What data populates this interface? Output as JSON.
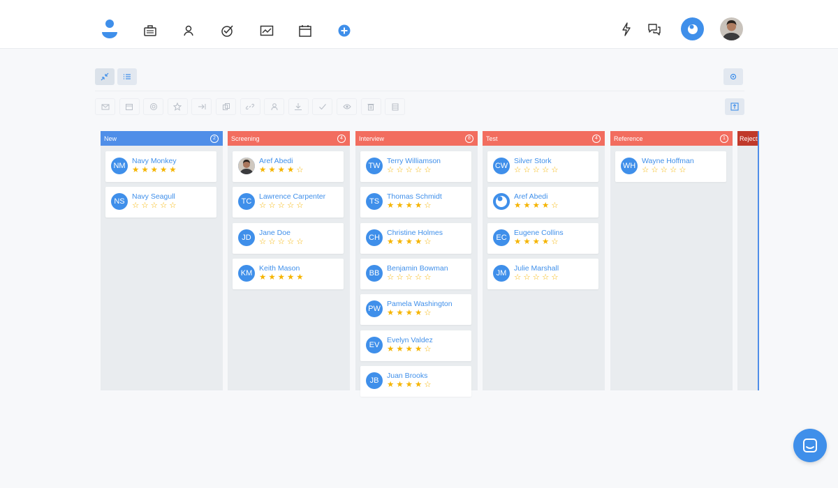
{
  "header": {
    "nav_icons": [
      "jobs-briefcase-icon",
      "candidates-icon",
      "tasks-check-icon",
      "reports-chart-icon",
      "calendar-icon",
      "add-plus-icon"
    ],
    "right_icons": [
      "lightning-icon",
      "chat-icon",
      "brand-avatar",
      "user-avatar"
    ],
    "accent": "#3f8fea"
  },
  "toolbar": {
    "view_icons": [
      "collapse-icon",
      "list-view-icon"
    ],
    "actions": [
      "email-icon",
      "calendar-icon",
      "target-icon",
      "star-icon",
      "move-icon",
      "copy-icon",
      "link-icon",
      "user-icon",
      "download-icon",
      "check-icon",
      "eye-icon",
      "trash-icon",
      "archive-icon"
    ],
    "settings_icon": "settings-gear-icon",
    "export_icon": "export-icon"
  },
  "board": {
    "columns": [
      {
        "title": "New",
        "count": "2",
        "color": "#4f8ee8",
        "cards": [
          {
            "initials": "NM",
            "name": "Navy Monkey",
            "rating": 5
          },
          {
            "initials": "NS",
            "name": "Navy Seagull",
            "rating": 0
          }
        ]
      },
      {
        "title": "Screening",
        "count": "4",
        "color": "#f26d5f",
        "cards": [
          {
            "initials": "",
            "name": "Aref Abedi",
            "rating": 4
          },
          {
            "initials": "TC",
            "name": "Lawrence Carpenter",
            "rating": 0
          },
          {
            "initials": "JD",
            "name": "Jane Doe",
            "rating": 0
          },
          {
            "initials": "KM",
            "name": "Keith Mason",
            "rating": 5
          }
        ]
      },
      {
        "title": "Interview",
        "count": "8",
        "color": "#f26d5f",
        "cards": [
          {
            "initials": "TW",
            "name": "Terry Williamson",
            "rating": 0
          },
          {
            "initials": "TS",
            "name": "Thomas Schmidt",
            "rating": 4
          },
          {
            "initials": "CH",
            "name": "Christine Holmes",
            "rating": 4
          },
          {
            "initials": "BB",
            "name": "Benjamin Bowman",
            "rating": 0
          },
          {
            "initials": "PW",
            "name": "Pamela Washington",
            "rating": 4
          },
          {
            "initials": "EV",
            "name": "Evelyn Valdez",
            "rating": 4
          },
          {
            "initials": "JB",
            "name": "Juan Brooks",
            "rating": 4
          }
        ]
      },
      {
        "title": "Test",
        "count": "4",
        "color": "#f26d5f",
        "cards": [
          {
            "initials": "CW",
            "name": "Silver Stork",
            "rating": 0
          },
          {
            "initials": "",
            "name": "Aref Abedi",
            "rating": 4
          },
          {
            "initials": "EC",
            "name": "Eugene Collins",
            "rating": 4
          },
          {
            "initials": "JM",
            "name": "Julie Marshall",
            "rating": 0
          }
        ]
      },
      {
        "title": "Reference",
        "count": "1",
        "color": "#f26d5f",
        "cards": [
          {
            "initials": "WH",
            "name": "Wayne Hoffman",
            "rating": 0
          }
        ]
      }
    ],
    "partial_column": {
      "title": "Reject",
      "color": "#c0392b"
    }
  }
}
